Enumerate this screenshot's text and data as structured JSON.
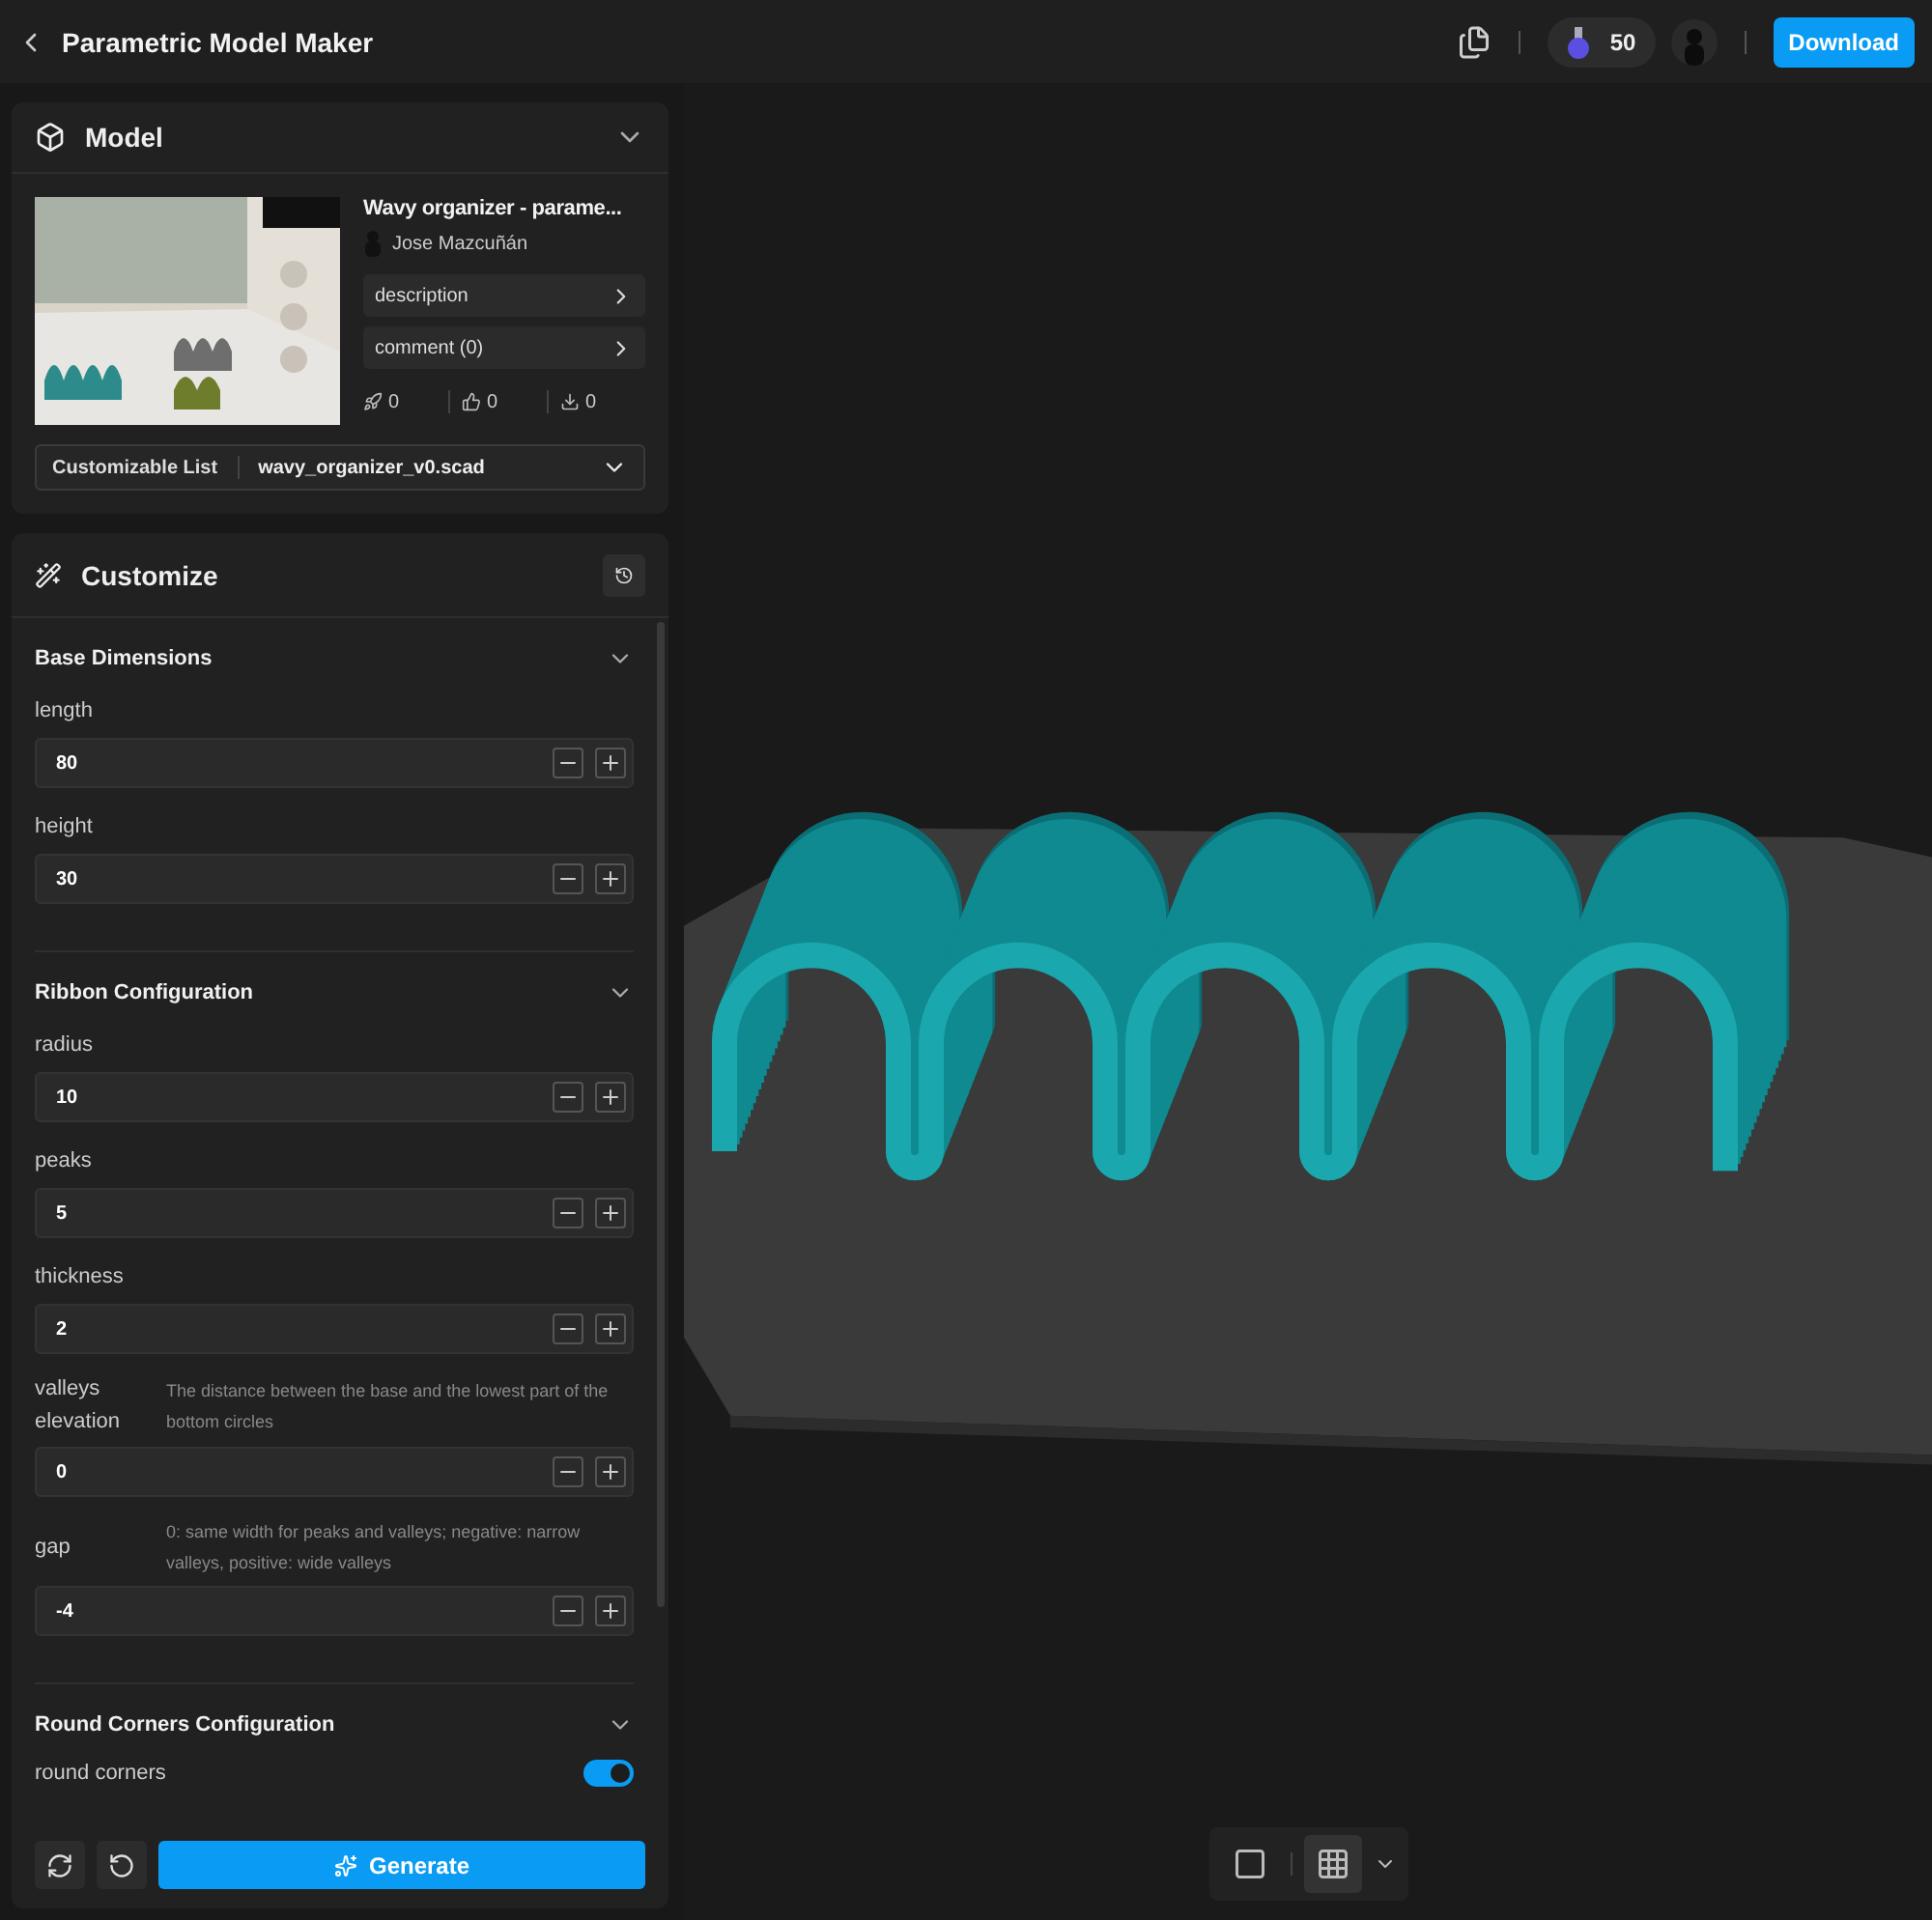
{
  "header": {
    "title": "Parametric Model Maker",
    "credits": "50",
    "download": "Download"
  },
  "model": {
    "heading": "Model",
    "expanded": true,
    "name": "Wavy organizer - parame...",
    "author": "Jose Mazcuñán",
    "links": [
      {
        "label": "description"
      },
      {
        "label": "comment",
        "count": "(0)"
      }
    ],
    "stats": [
      {
        "kind": "boost",
        "value": "0"
      },
      {
        "kind": "like",
        "value": "0"
      },
      {
        "kind": "download",
        "value": "0"
      }
    ],
    "list_label": "Customizable List",
    "file": "wavy_organizer_v0.scad"
  },
  "customize": {
    "heading": "Customize",
    "groups": [
      {
        "title": "Base Dimensions",
        "expanded": true,
        "params": [
          {
            "kind": "number",
            "label": "length",
            "value": "80"
          },
          {
            "kind": "number",
            "label": "height",
            "value": "30"
          }
        ]
      },
      {
        "title": "Ribbon Configuration",
        "expanded": true,
        "params": [
          {
            "kind": "number",
            "label": "radius",
            "value": "10"
          },
          {
            "kind": "number",
            "label": "peaks",
            "value": "5"
          },
          {
            "kind": "number",
            "label": "thickness",
            "value": "2"
          },
          {
            "kind": "number",
            "label": "valleys elevation",
            "description": "The distance between the base and the lowest part of the bottom circles",
            "value": "0"
          },
          {
            "kind": "number",
            "label": "gap",
            "description": "0: same width for peaks and valleys; negative: narrow valleys, positive: wide valleys",
            "value": "-4"
          }
        ]
      },
      {
        "title": "Round Corners Configuration",
        "expanded": true,
        "params": [
          {
            "kind": "toggle",
            "label": "round corners",
            "on": true
          }
        ]
      }
    ],
    "generate": "Generate"
  },
  "viewport": {
    "tools": [
      {
        "kind": "square",
        "selected": false
      },
      {
        "kind": "grid",
        "selected": true
      }
    ]
  }
}
